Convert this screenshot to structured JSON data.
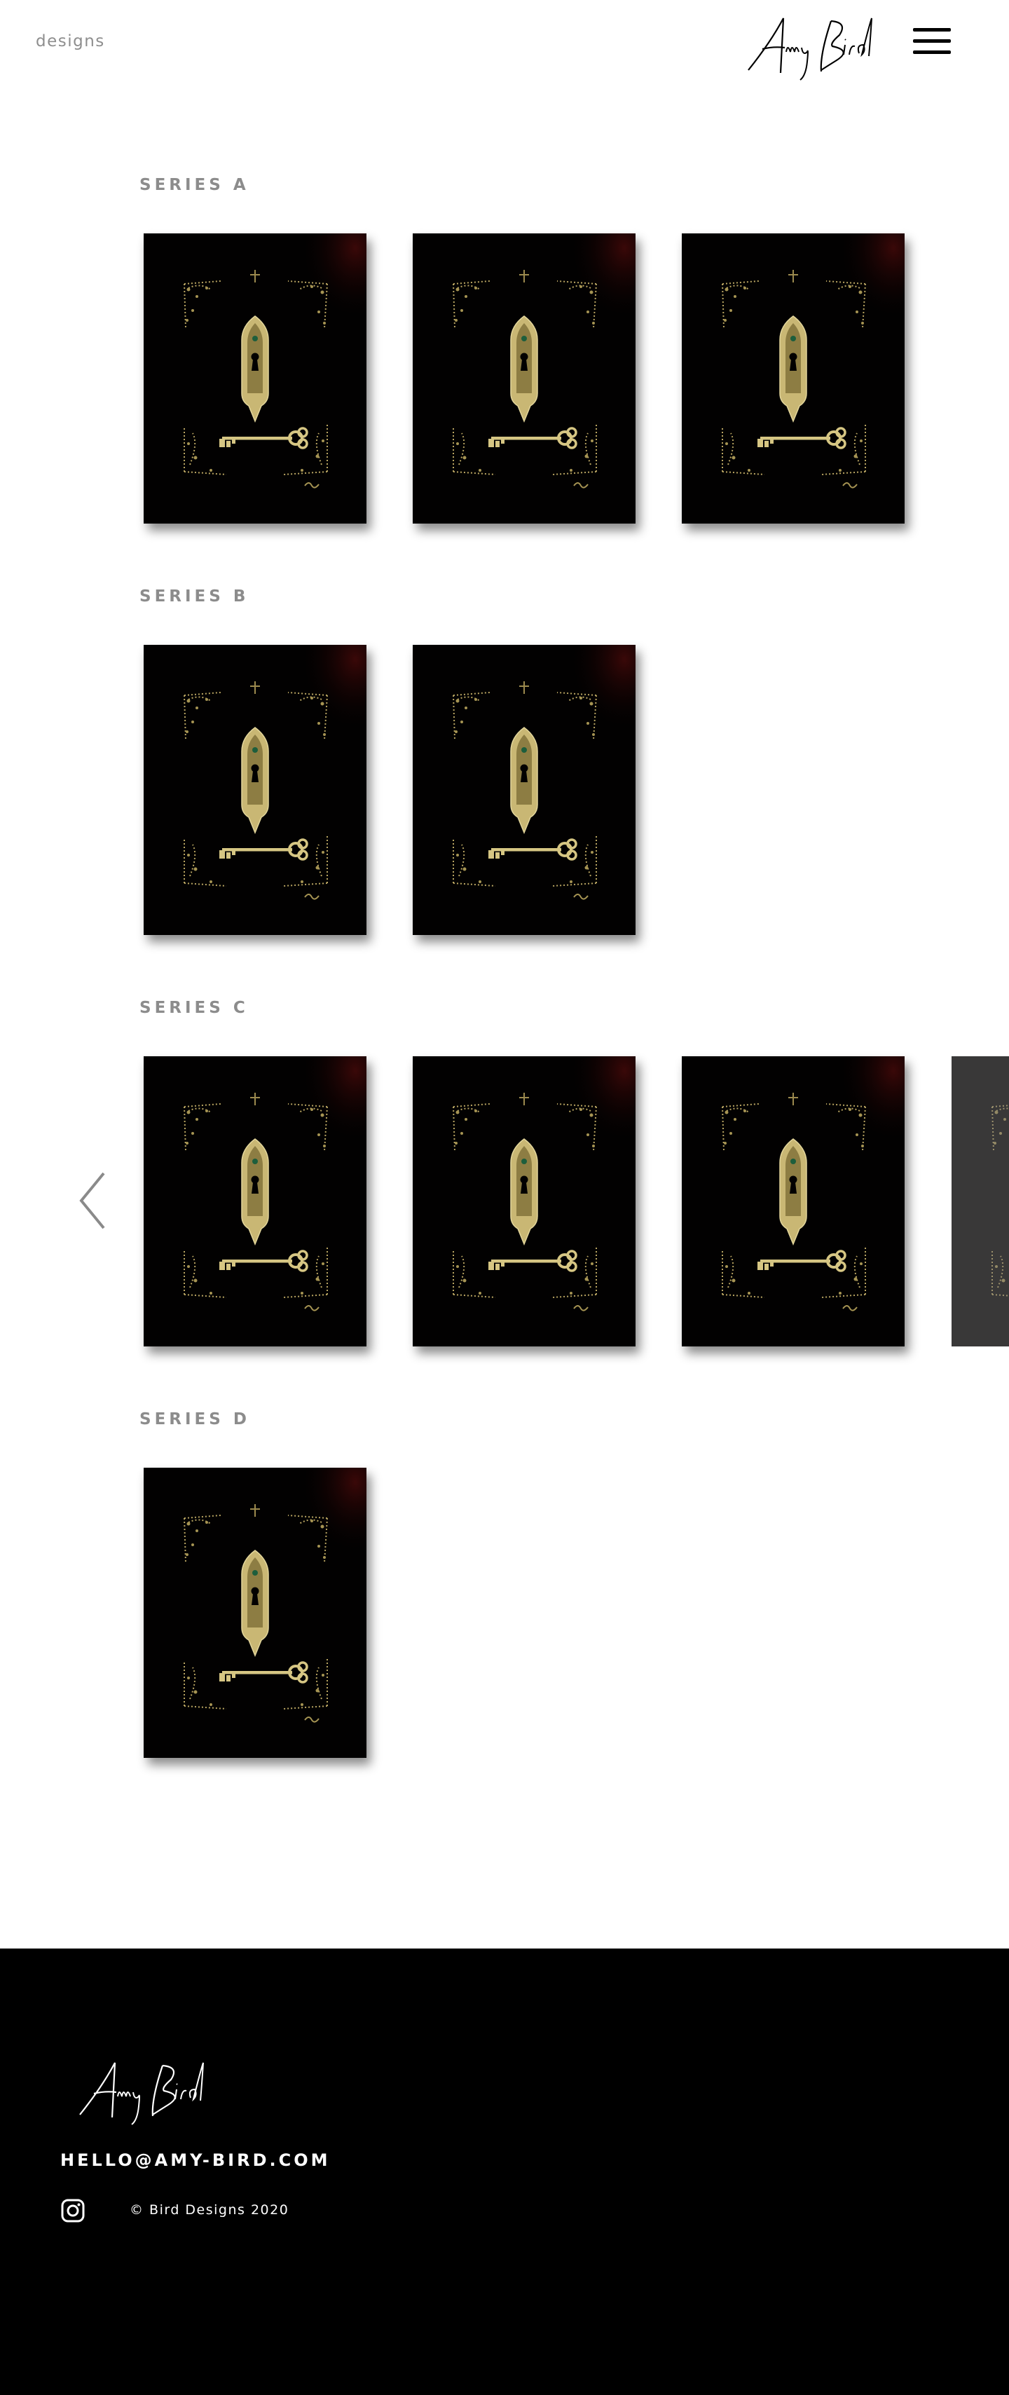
{
  "header": {
    "page_label": "designs",
    "logo_text": "Amy Bird",
    "menu_icon": "hamburger-menu-icon"
  },
  "series": [
    {
      "title": "SERIES A",
      "images": [
        "keyhole-key-print",
        "keyhole-key-print",
        "keyhole-key-print"
      ]
    },
    {
      "title": "SERIES B",
      "images": [
        "keyhole-key-print",
        "keyhole-key-print"
      ]
    },
    {
      "title": "SERIES C",
      "images": [
        "keyhole-key-print",
        "keyhole-key-print",
        "keyhole-key-print",
        "keyhole-key-print"
      ]
    },
    {
      "title": "SERIES D",
      "images": [
        "keyhole-key-print"
      ]
    }
  ],
  "carousel": {
    "prev_icon": "chevron-left-icon"
  },
  "footer": {
    "logo_text": "Amy Bird",
    "email": "HELLO@AMY-BIRD.COM",
    "social_icon": "instagram-icon",
    "copyright": "© Bird Designs 2020"
  },
  "colors": {
    "background": "#ffffff",
    "footer_bg": "#000000",
    "series_title": "#8c8c8c",
    "artwork_gold": "#c9b774",
    "artwork_bg": "#020101"
  }
}
